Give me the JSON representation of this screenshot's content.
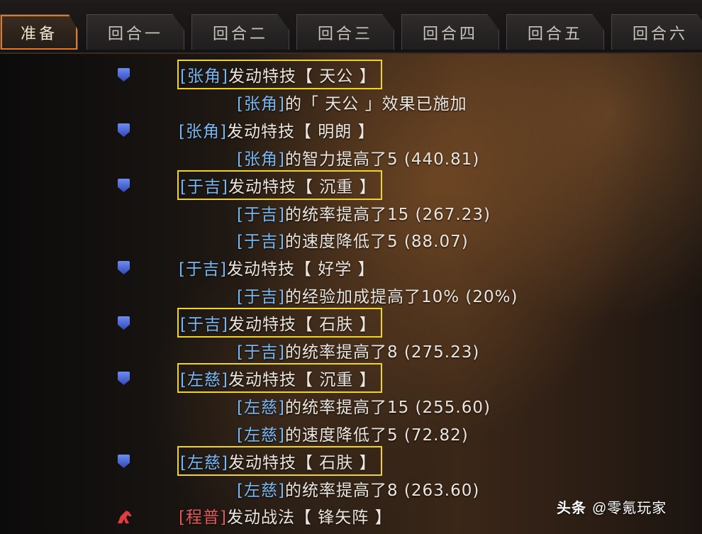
{
  "tabs": [
    {
      "label": "准备",
      "active": true
    },
    {
      "label": "回合一"
    },
    {
      "label": "回合二"
    },
    {
      "label": "回合三"
    },
    {
      "label": "回合四"
    },
    {
      "label": "回合五"
    },
    {
      "label": "回合六"
    }
  ],
  "log": [
    {
      "icon": "shield-icon",
      "name": "[张角]",
      "text": "发动特技【 天公 】",
      "hl": true
    },
    {
      "name": "[张角]",
      "text": "的「 天公 」效果已施加"
    },
    {
      "icon": "shield-icon",
      "name": "[张角]",
      "text": "发动特技【 明朗 】"
    },
    {
      "name": "[张角]",
      "text": "的智力提高了5 (440.81)"
    },
    {
      "icon": "shield-icon",
      "name": "[于吉]",
      "text": "发动特技【 沉重 】",
      "hl": true
    },
    {
      "name": "[于吉]",
      "text": "的统率提高了15 (267.23)"
    },
    {
      "name": "[于吉]",
      "text": "的速度降低了5 (88.07)"
    },
    {
      "icon": "shield-icon",
      "name": "[于吉]",
      "text": "发动特技【 好学 】"
    },
    {
      "name": "[于吉]",
      "text": "的经验加成提高了10% (20%)"
    },
    {
      "icon": "shield-icon",
      "name": "[于吉]",
      "text": "发动特技【 石肤 】",
      "hl": true
    },
    {
      "name": "[于吉]",
      "text": "的统率提高了8 (275.23)"
    },
    {
      "icon": "shield-icon",
      "name": "[左慈]",
      "text": "发动特技【 沉重 】",
      "hl": true
    },
    {
      "name": "[左慈]",
      "text": "的统率提高了15 (255.60)"
    },
    {
      "name": "[左慈]",
      "text": "的速度降低了5 (72.82)"
    },
    {
      "icon": "shield-icon",
      "name": "[左慈]",
      "text": "发动特技【 石肤 】",
      "hl": true
    },
    {
      "name": "[左慈]",
      "text": "的统率提高了8 (263.60)"
    },
    {
      "icon": "horse-icon",
      "name": "[程普]",
      "name_color": "red",
      "text": "发动战法【 锋矢阵 】"
    }
  ],
  "watermark": {
    "brand": "头条",
    "handle": "@零氪玩家"
  }
}
